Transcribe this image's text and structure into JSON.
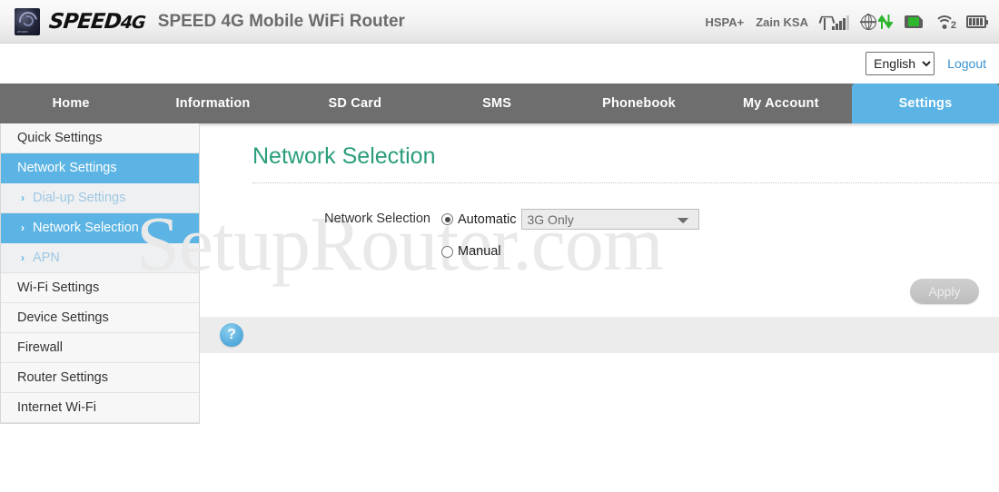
{
  "header": {
    "logo_text": "SPEED",
    "logo_text_suffix": "4G",
    "logo_badge_label": "zhone",
    "title": "SPEED 4G Mobile WiFi Router",
    "status": {
      "network_type": "HSPA+",
      "carrier": "Zain KSA",
      "signal_icon": "signal-bars-icon",
      "globe_icon": "globe-data-transfer-icon",
      "sim_icon": "sim-card-icon",
      "wifi_icon": "wifi-icon",
      "wifi_client_count": "2",
      "battery_icon": "battery-icon"
    }
  },
  "sub_header": {
    "language_selected": "English",
    "language_options": [
      "English"
    ],
    "logout_label": "Logout"
  },
  "nav": {
    "items": [
      {
        "label": "Home",
        "active": false
      },
      {
        "label": "Information",
        "active": false
      },
      {
        "label": "SD Card",
        "active": false
      },
      {
        "label": "SMS",
        "active": false
      },
      {
        "label": "Phonebook",
        "active": false
      },
      {
        "label": "My Account",
        "active": false
      },
      {
        "label": "Settings",
        "active": true
      }
    ],
    "active_color": "#5cb4e4",
    "bar_color": "#6e6e6e"
  },
  "sidebar": {
    "items": [
      {
        "label": "Quick Settings",
        "type": "item",
        "active": false
      },
      {
        "label": "Network Settings",
        "type": "item",
        "active": true
      },
      {
        "label": "Dial-up Settings",
        "type": "sub",
        "active": false
      },
      {
        "label": "Network Selection",
        "type": "sub",
        "active": true
      },
      {
        "label": "APN",
        "type": "sub",
        "active": false
      },
      {
        "label": "Wi-Fi Settings",
        "type": "item",
        "active": false
      },
      {
        "label": "Device Settings",
        "type": "item",
        "active": false
      },
      {
        "label": "Firewall",
        "type": "item",
        "active": false
      },
      {
        "label": "Router Settings",
        "type": "item",
        "active": false
      },
      {
        "label": "Internet Wi-Fi",
        "type": "item",
        "active": false
      }
    ],
    "chevron_icon": "chevron-right-icon"
  },
  "main": {
    "page_title": "Network Selection",
    "page_title_color": "#2a9d7c",
    "form": {
      "label": "Network Selection",
      "options": [
        {
          "label": "Automatic",
          "checked": true
        },
        {
          "label": "Manual",
          "checked": false
        }
      ],
      "mode_select": {
        "value": "3G Only",
        "options": [
          "3G Only"
        ],
        "disabled": true
      }
    },
    "apply_label": "Apply",
    "help_icon": "question-mark-help-icon",
    "help_glyph": "?"
  },
  "watermark": {
    "text": "SetupRouter.com"
  }
}
